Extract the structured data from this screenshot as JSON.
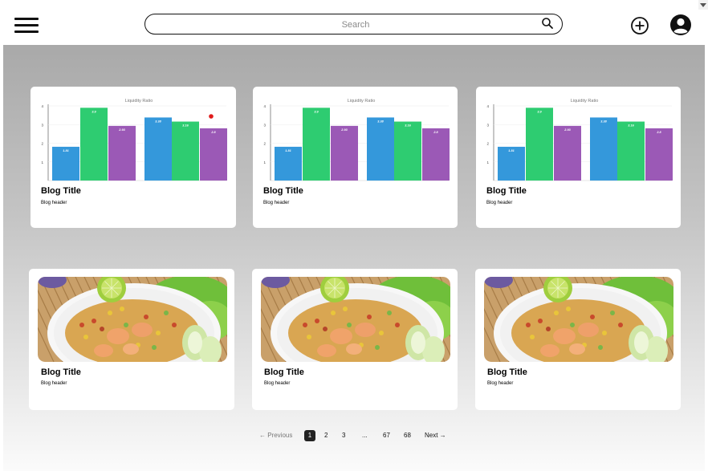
{
  "header": {
    "search_placeholder": "Search"
  },
  "cards": [
    {
      "kind": "chart",
      "title": "Blog Title",
      "subtitle": "Blog header"
    },
    {
      "kind": "chart",
      "title": "Blog Title",
      "subtitle": "Blog header"
    },
    {
      "kind": "chart",
      "title": "Blog Title",
      "subtitle": "Blog header"
    },
    {
      "kind": "image",
      "title": "Blog Title",
      "subtitle": "Blog header"
    },
    {
      "kind": "image",
      "title": "Blog Title",
      "subtitle": "Blog header"
    },
    {
      "kind": "image",
      "title": "Blog Title",
      "subtitle": "Blog header"
    }
  ],
  "chart_data": {
    "type": "bar",
    "title": "Liquidity Ratio",
    "ylim": [
      0,
      4
    ],
    "yticks": [
      "1",
      "2",
      "3",
      "4"
    ],
    "values": [
      1.81,
      3.9,
      2.93,
      3.38,
      3.16,
      2.8
    ],
    "value_labels": [
      "1.81",
      "3.9",
      "2.93",
      "3.38",
      "3.16",
      "2.8"
    ],
    "colors": [
      "#3498db",
      "#2ecc71",
      "#9b59b6",
      "#3498db",
      "#2ecc71",
      "#9b59b6"
    ]
  },
  "pagination": {
    "previous": "← Previous",
    "pages": [
      "1",
      "2",
      "3",
      "...",
      "67",
      "68"
    ],
    "active": "1",
    "next": "Next →"
  },
  "colors": {
    "bar_blue": "#3498db",
    "bar_green": "#2ecc71",
    "bar_purple": "#9b59b6",
    "marker_red": "#e01b1b"
  }
}
